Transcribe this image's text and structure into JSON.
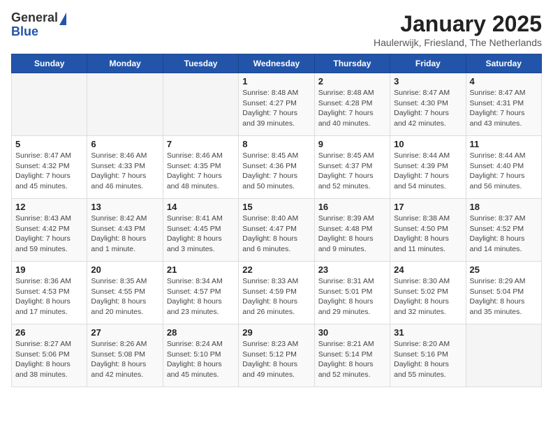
{
  "header": {
    "logo_general": "General",
    "logo_blue": "Blue",
    "month_title": "January 2025",
    "subtitle": "Haulerwijk, Friesland, The Netherlands"
  },
  "weekdays": [
    "Sunday",
    "Monday",
    "Tuesday",
    "Wednesday",
    "Thursday",
    "Friday",
    "Saturday"
  ],
  "weeks": [
    [
      {
        "day": "",
        "sunrise": "",
        "sunset": "",
        "daylight": ""
      },
      {
        "day": "",
        "sunrise": "",
        "sunset": "",
        "daylight": ""
      },
      {
        "day": "",
        "sunrise": "",
        "sunset": "",
        "daylight": ""
      },
      {
        "day": "1",
        "sunrise": "Sunrise: 8:48 AM",
        "sunset": "Sunset: 4:27 PM",
        "daylight": "Daylight: 7 hours and 39 minutes."
      },
      {
        "day": "2",
        "sunrise": "Sunrise: 8:48 AM",
        "sunset": "Sunset: 4:28 PM",
        "daylight": "Daylight: 7 hours and 40 minutes."
      },
      {
        "day": "3",
        "sunrise": "Sunrise: 8:47 AM",
        "sunset": "Sunset: 4:30 PM",
        "daylight": "Daylight: 7 hours and 42 minutes."
      },
      {
        "day": "4",
        "sunrise": "Sunrise: 8:47 AM",
        "sunset": "Sunset: 4:31 PM",
        "daylight": "Daylight: 7 hours and 43 minutes."
      }
    ],
    [
      {
        "day": "5",
        "sunrise": "Sunrise: 8:47 AM",
        "sunset": "Sunset: 4:32 PM",
        "daylight": "Daylight: 7 hours and 45 minutes."
      },
      {
        "day": "6",
        "sunrise": "Sunrise: 8:46 AM",
        "sunset": "Sunset: 4:33 PM",
        "daylight": "Daylight: 7 hours and 46 minutes."
      },
      {
        "day": "7",
        "sunrise": "Sunrise: 8:46 AM",
        "sunset": "Sunset: 4:35 PM",
        "daylight": "Daylight: 7 hours and 48 minutes."
      },
      {
        "day": "8",
        "sunrise": "Sunrise: 8:45 AM",
        "sunset": "Sunset: 4:36 PM",
        "daylight": "Daylight: 7 hours and 50 minutes."
      },
      {
        "day": "9",
        "sunrise": "Sunrise: 8:45 AM",
        "sunset": "Sunset: 4:37 PM",
        "daylight": "Daylight: 7 hours and 52 minutes."
      },
      {
        "day": "10",
        "sunrise": "Sunrise: 8:44 AM",
        "sunset": "Sunset: 4:39 PM",
        "daylight": "Daylight: 7 hours and 54 minutes."
      },
      {
        "day": "11",
        "sunrise": "Sunrise: 8:44 AM",
        "sunset": "Sunset: 4:40 PM",
        "daylight": "Daylight: 7 hours and 56 minutes."
      }
    ],
    [
      {
        "day": "12",
        "sunrise": "Sunrise: 8:43 AM",
        "sunset": "Sunset: 4:42 PM",
        "daylight": "Daylight: 7 hours and 59 minutes."
      },
      {
        "day": "13",
        "sunrise": "Sunrise: 8:42 AM",
        "sunset": "Sunset: 4:43 PM",
        "daylight": "Daylight: 8 hours and 1 minute."
      },
      {
        "day": "14",
        "sunrise": "Sunrise: 8:41 AM",
        "sunset": "Sunset: 4:45 PM",
        "daylight": "Daylight: 8 hours and 3 minutes."
      },
      {
        "day": "15",
        "sunrise": "Sunrise: 8:40 AM",
        "sunset": "Sunset: 4:47 PM",
        "daylight": "Daylight: 8 hours and 6 minutes."
      },
      {
        "day": "16",
        "sunrise": "Sunrise: 8:39 AM",
        "sunset": "Sunset: 4:48 PM",
        "daylight": "Daylight: 8 hours and 9 minutes."
      },
      {
        "day": "17",
        "sunrise": "Sunrise: 8:38 AM",
        "sunset": "Sunset: 4:50 PM",
        "daylight": "Daylight: 8 hours and 11 minutes."
      },
      {
        "day": "18",
        "sunrise": "Sunrise: 8:37 AM",
        "sunset": "Sunset: 4:52 PM",
        "daylight": "Daylight: 8 hours and 14 minutes."
      }
    ],
    [
      {
        "day": "19",
        "sunrise": "Sunrise: 8:36 AM",
        "sunset": "Sunset: 4:53 PM",
        "daylight": "Daylight: 8 hours and 17 minutes."
      },
      {
        "day": "20",
        "sunrise": "Sunrise: 8:35 AM",
        "sunset": "Sunset: 4:55 PM",
        "daylight": "Daylight: 8 hours and 20 minutes."
      },
      {
        "day": "21",
        "sunrise": "Sunrise: 8:34 AM",
        "sunset": "Sunset: 4:57 PM",
        "daylight": "Daylight: 8 hours and 23 minutes."
      },
      {
        "day": "22",
        "sunrise": "Sunrise: 8:33 AM",
        "sunset": "Sunset: 4:59 PM",
        "daylight": "Daylight: 8 hours and 26 minutes."
      },
      {
        "day": "23",
        "sunrise": "Sunrise: 8:31 AM",
        "sunset": "Sunset: 5:01 PM",
        "daylight": "Daylight: 8 hours and 29 minutes."
      },
      {
        "day": "24",
        "sunrise": "Sunrise: 8:30 AM",
        "sunset": "Sunset: 5:02 PM",
        "daylight": "Daylight: 8 hours and 32 minutes."
      },
      {
        "day": "25",
        "sunrise": "Sunrise: 8:29 AM",
        "sunset": "Sunset: 5:04 PM",
        "daylight": "Daylight: 8 hours and 35 minutes."
      }
    ],
    [
      {
        "day": "26",
        "sunrise": "Sunrise: 8:27 AM",
        "sunset": "Sunset: 5:06 PM",
        "daylight": "Daylight: 8 hours and 38 minutes."
      },
      {
        "day": "27",
        "sunrise": "Sunrise: 8:26 AM",
        "sunset": "Sunset: 5:08 PM",
        "daylight": "Daylight: 8 hours and 42 minutes."
      },
      {
        "day": "28",
        "sunrise": "Sunrise: 8:24 AM",
        "sunset": "Sunset: 5:10 PM",
        "daylight": "Daylight: 8 hours and 45 minutes."
      },
      {
        "day": "29",
        "sunrise": "Sunrise: 8:23 AM",
        "sunset": "Sunset: 5:12 PM",
        "daylight": "Daylight: 8 hours and 49 minutes."
      },
      {
        "day": "30",
        "sunrise": "Sunrise: 8:21 AM",
        "sunset": "Sunset: 5:14 PM",
        "daylight": "Daylight: 8 hours and 52 minutes."
      },
      {
        "day": "31",
        "sunrise": "Sunrise: 8:20 AM",
        "sunset": "Sunset: 5:16 PM",
        "daylight": "Daylight: 8 hours and 55 minutes."
      },
      {
        "day": "",
        "sunrise": "",
        "sunset": "",
        "daylight": ""
      }
    ]
  ]
}
